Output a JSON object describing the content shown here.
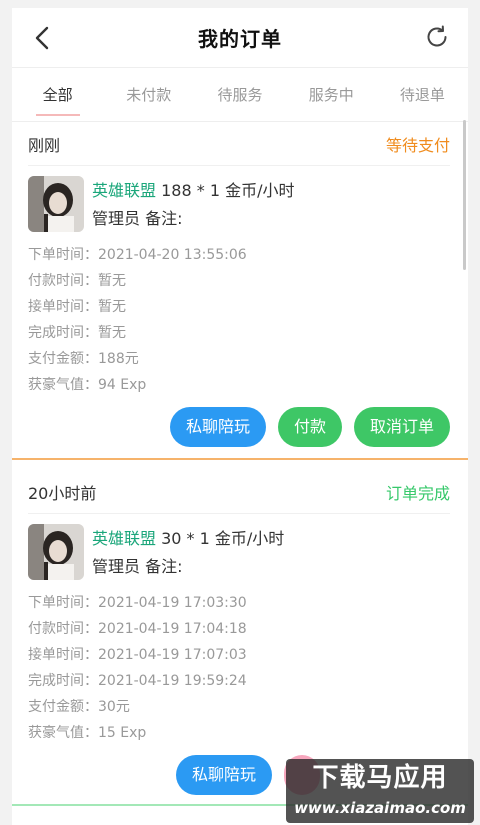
{
  "header": {
    "title": "我的订单",
    "back_icon": "chevron-left-icon",
    "refresh_icon": "refresh-icon"
  },
  "tabs": [
    {
      "label": "全部",
      "active": true
    },
    {
      "label": "未付款",
      "active": false
    },
    {
      "label": "待服务",
      "active": false
    },
    {
      "label": "服务中",
      "active": false
    },
    {
      "label": "待退单",
      "active": false
    }
  ],
  "orders": [
    {
      "time_label": "刚刚",
      "status": "等待支付",
      "status_color": "#f08c1e",
      "game": "英雄联盟",
      "price_text": " 188 * 1 金币/小时",
      "line2": "管理员 备注:",
      "details": [
        "下单时间：2021-04-20 13:55:06",
        "付款时间：暂无",
        "接单时间：暂无",
        "完成时间：暂无",
        "支付金额：188元",
        "获豪气值：94 Exp"
      ],
      "buttons": [
        "私聊陪玩",
        "付款",
        "取消订单"
      ]
    },
    {
      "time_label": "20小时前",
      "status": "订单完成",
      "status_color": "#36c86a",
      "game": "英雄联盟",
      "price_text": " 30 * 1 金币/小时",
      "line2": "管理员 备注:",
      "details": [
        "下单时间：2021-04-19 17:03:30",
        "付款时间：2021-04-19 17:04:18",
        "接单时间：2021-04-19 17:07:03",
        "完成时间：2021-04-19 19:59:24",
        "支付金额：30元",
        "获豪气值：15 Exp"
      ],
      "buttons": [
        "私聊陪玩"
      ]
    }
  ],
  "watermark": {
    "title": "下载马应用",
    "url": "www.xiazaimao.com"
  }
}
